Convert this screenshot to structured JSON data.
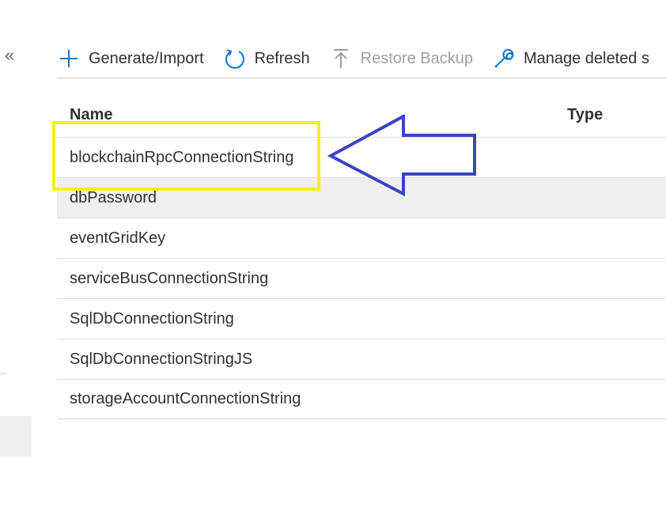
{
  "sidebar": {
    "collapse_glyph": "«"
  },
  "toolbar": {
    "buttons": [
      {
        "label": "Generate/Import",
        "icon": "plus-icon",
        "disabled": false
      },
      {
        "label": "Refresh",
        "icon": "refresh-icon",
        "disabled": false
      },
      {
        "label": "Restore Backup",
        "icon": "upload-icon",
        "disabled": true
      },
      {
        "label": "Manage deleted s",
        "icon": "wrench-icon",
        "disabled": false
      }
    ]
  },
  "table": {
    "columns": [
      "Name",
      "Type"
    ],
    "rows": [
      "blockchainRpcConnectionString",
      "dbPassword",
      "eventGridKey",
      "serviceBusConnectionString",
      "SqlDbConnectionString",
      "SqlDbConnectionStringJS",
      "storageAccountConnectionString"
    ],
    "selected_index": 1
  },
  "annotation": {
    "highlight_color": "#f5ef1a",
    "arrow_color": "#3a44c4",
    "target_row": "blockchainRpcConnectionString"
  }
}
